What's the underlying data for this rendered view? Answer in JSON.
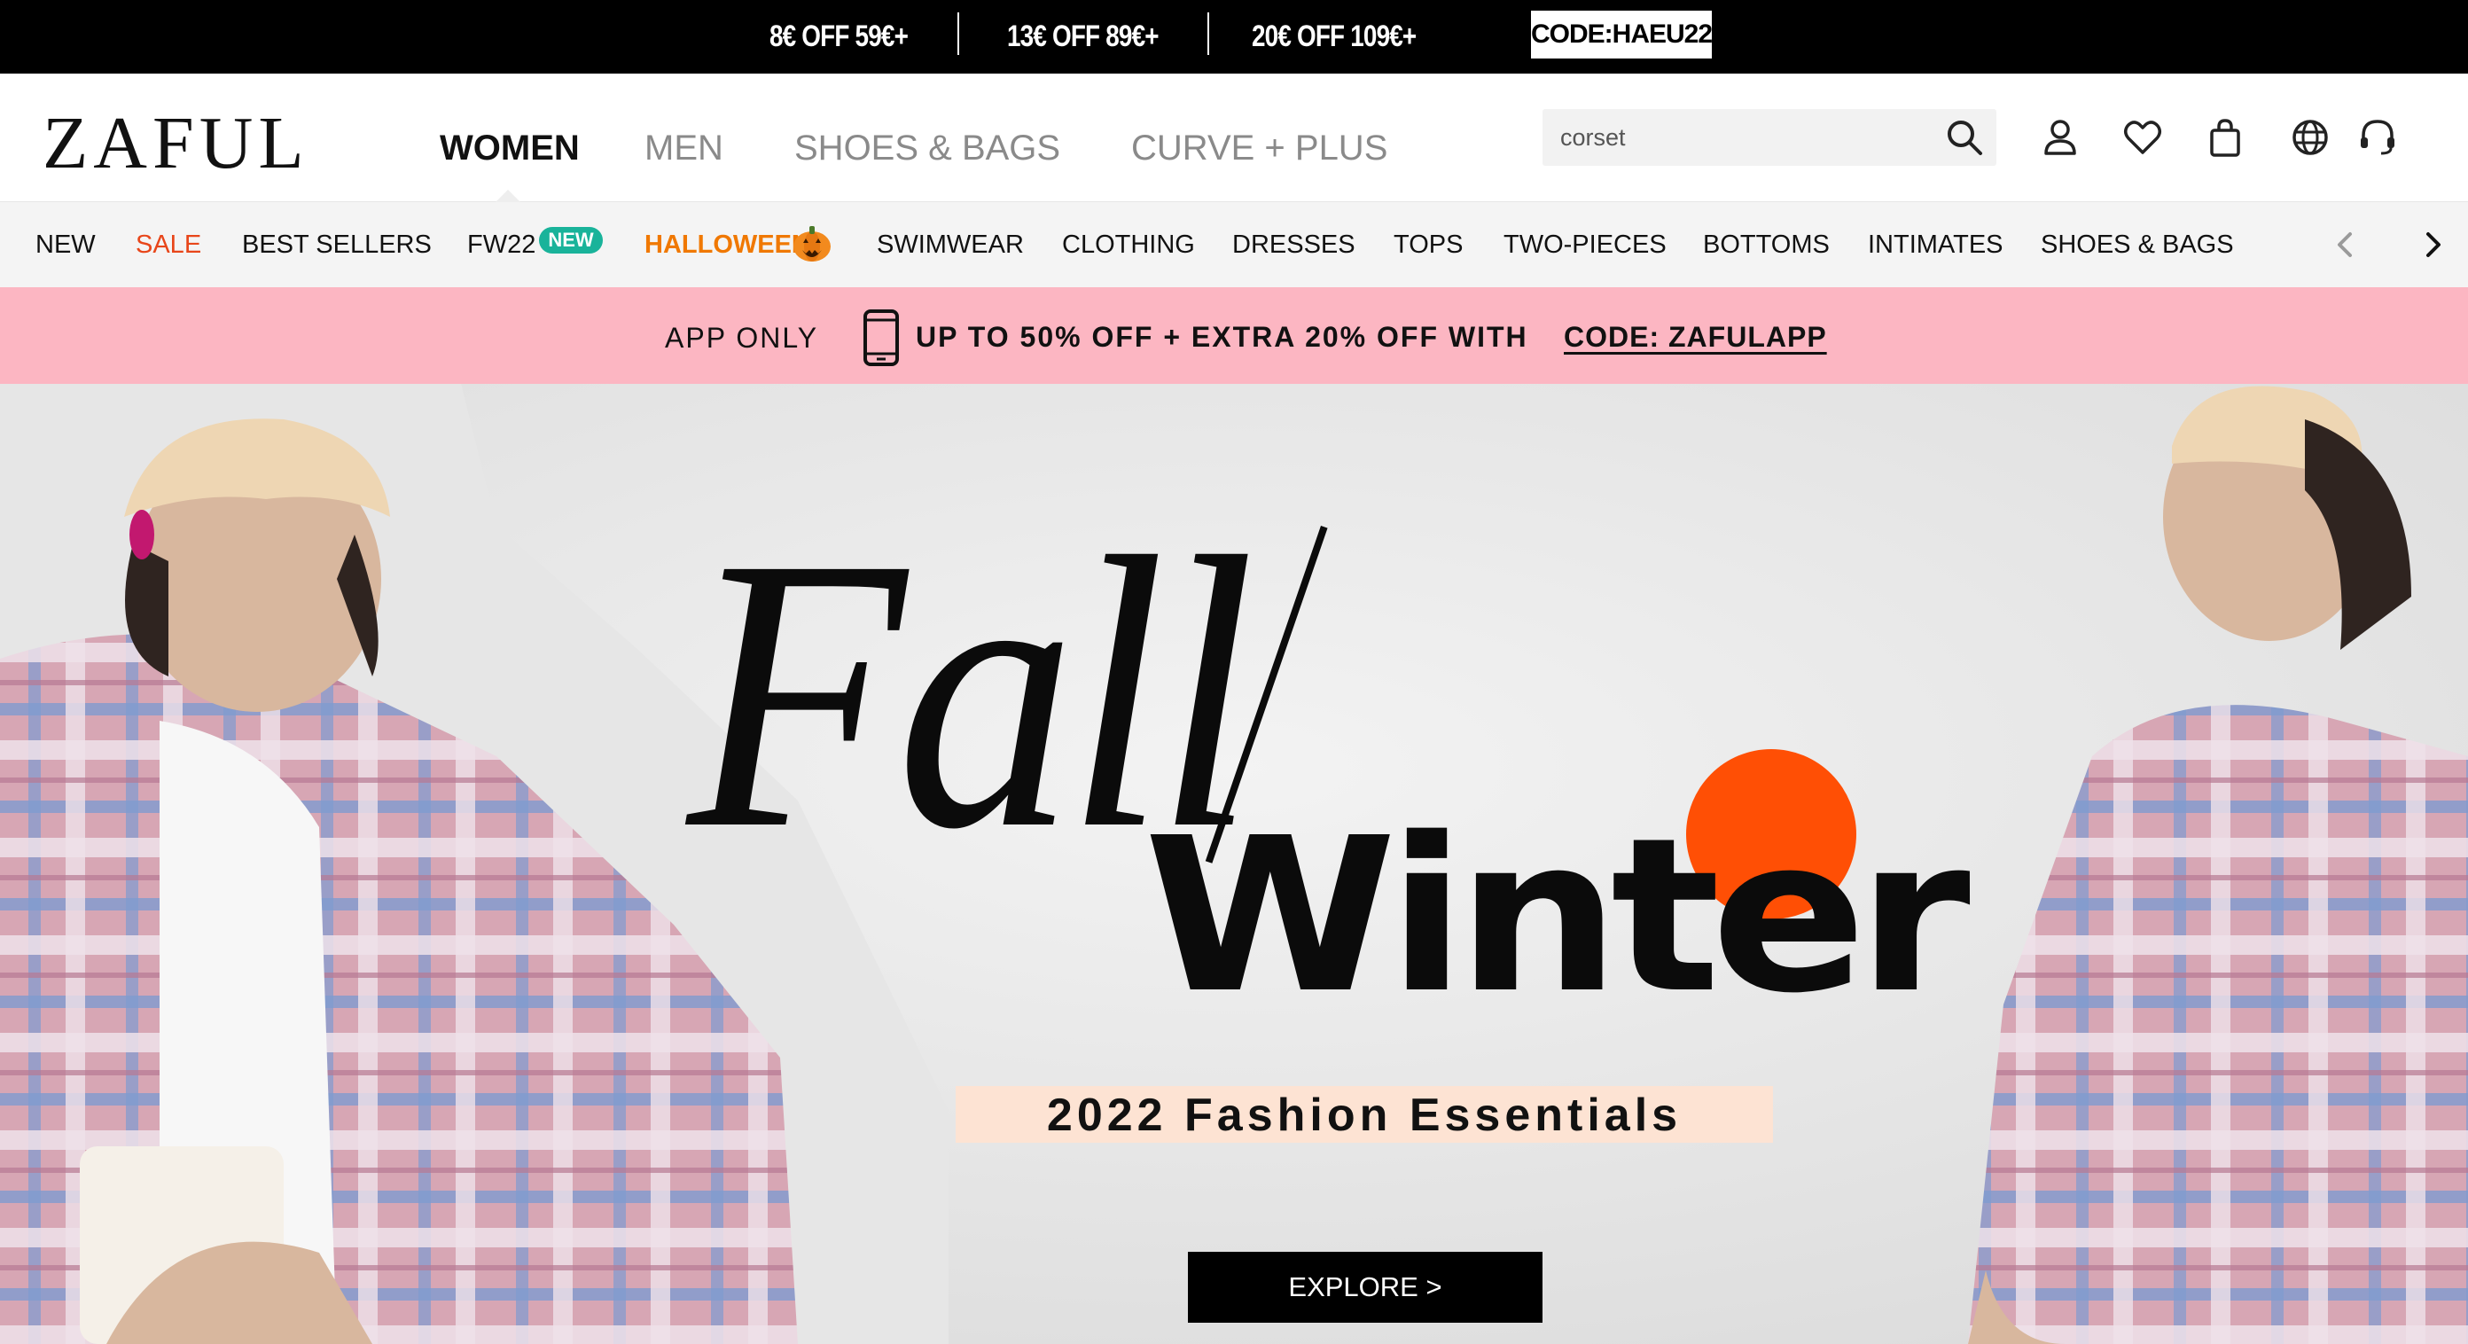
{
  "promo_bar": {
    "offers": [
      "8€ OFF 59€+",
      "13€ OFF 89€+",
      "20€ OFF 109€+"
    ],
    "code": "CODE:HAEU22"
  },
  "header": {
    "logo": "ZAFUL",
    "nav": [
      "WOMEN",
      "MEN",
      "SHOES & BAGS",
      "CURVE + PLUS"
    ],
    "active_nav": "WOMEN",
    "search": {
      "value": "corset"
    },
    "icons": [
      "search-icon",
      "account-icon",
      "wishlist-icon",
      "bag-icon",
      "globe-icon",
      "support-icon"
    ]
  },
  "category_nav": {
    "items": [
      "NEW",
      "SALE",
      "BEST SELLERS",
      "FW22",
      "HALLOWEEN",
      "SWIMWEAR",
      "CLOTHING",
      "DRESSES",
      "TOPS",
      "TWO-PIECES",
      "BOTTOMS",
      "INTIMATES",
      "SHOES & BAGS"
    ],
    "badge_new": "NEW",
    "sale_color": "#e8461a",
    "halloween_color": "#f07800"
  },
  "app_banner": {
    "label": "APP ONLY",
    "offer": "UP TO 50% OFF + EXTRA 20% OFF WITH",
    "code": "CODE: ZAFULAPP",
    "background": "#fcb6c2"
  },
  "hero": {
    "headline_1": "Fall",
    "headline_2": "Winter",
    "subtitle": "2022 Fashion Essentials",
    "cta": "EXPLORE >",
    "accent_color": "#ff4f05"
  }
}
